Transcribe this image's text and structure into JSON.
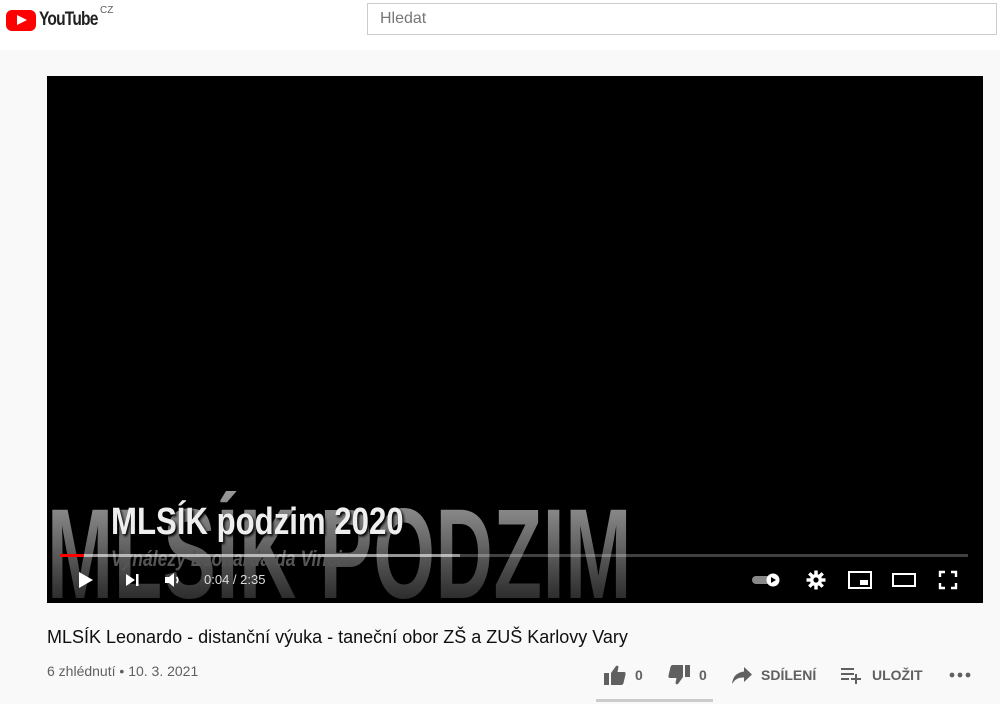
{
  "header": {
    "logo_text": "YouTube",
    "country_code": "CZ",
    "search_placeholder": "Hledat"
  },
  "player": {
    "overlay_big_text": "MLSÍK PODZIM 2020",
    "overlay_title": "MLSÍK podzim 2020",
    "overlay_subtitle": "Vynálezy Leonarda da Vinci",
    "current_time": "0:04",
    "duration": "2:35",
    "time_separator": " / ",
    "progress_fraction": 0.026,
    "buffered_fraction": 0.44
  },
  "video": {
    "title": "MLSÍK Leonardo - distanční výuka - taneční obor ZŠ a ZUŠ Karlovy Vary",
    "views": "6 zhlédnutí",
    "date": "10. 3. 2021"
  },
  "actions": {
    "likes": "0",
    "dislikes": "0",
    "share_label": "SDÍLENÍ",
    "save_label": "ULOŽIT"
  },
  "colors": {
    "brand": "#ff0000",
    "player_bg": "#000000",
    "page_bg": "#f9f9f9"
  }
}
